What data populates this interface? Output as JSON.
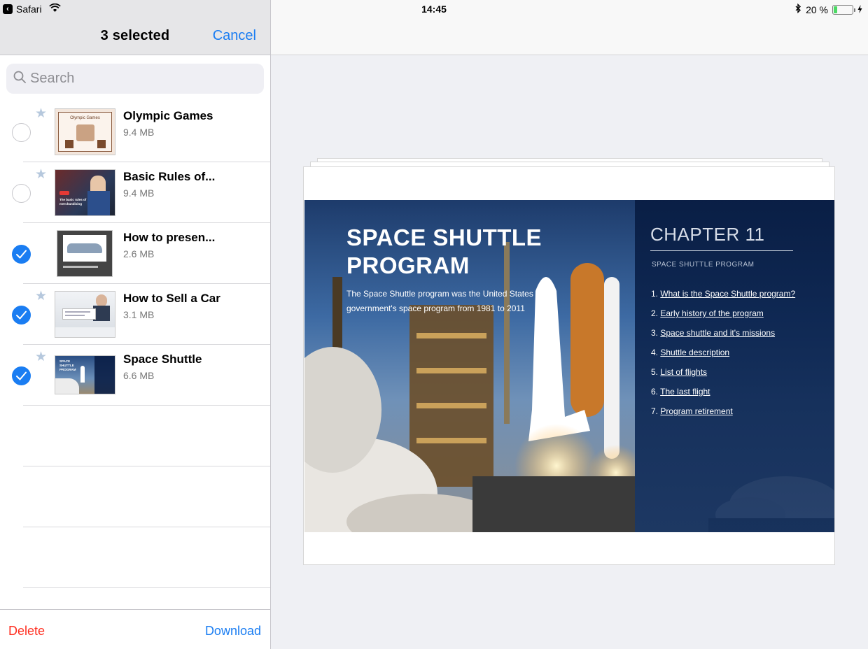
{
  "status_bar": {
    "app": "Safari",
    "time": "14:45",
    "battery_text": "20 %",
    "battery_level": 0.2
  },
  "left_panel": {
    "title": "3 selected",
    "cancel_label": "Cancel",
    "search_placeholder": "Search",
    "items": [
      {
        "name": "Olympic Games",
        "size": "9.4 MB",
        "selected": false,
        "starred": true,
        "thumb_title": "Olympic Games"
      },
      {
        "name": "Basic Rules of...",
        "size": "9.4 MB",
        "selected": false,
        "starred": true,
        "thumb_title": "The basic rules of merchandising"
      },
      {
        "name": "How to presen...",
        "size": "2.6 MB",
        "selected": true,
        "starred": false
      },
      {
        "name": "How to Sell a Car",
        "size": "3.1 MB",
        "selected": true,
        "starred": true
      },
      {
        "name": "Space Shuttle",
        "size": "6.6 MB",
        "selected": true,
        "starred": true,
        "thumb_title": "SPACE SHUTTLE PROGRAM"
      }
    ],
    "delete_label": "Delete",
    "download_label": "Download"
  },
  "preview": {
    "headline": "SPACE SHUTTLE PROGRAM",
    "subtitle": "The Space Shuttle program was the United States government's space program from 1981 to 2011",
    "chapter": "CHAPTER 11",
    "chapter_subtitle": "SPACE SHUTTLE PROGRAM",
    "toc": [
      {
        "num": "1.",
        "text": "What is the Space Shuttle program?"
      },
      {
        "num": "2.",
        "text": "Early history of the program"
      },
      {
        "num": "3.",
        "text": "Space shuttle and it's missions"
      },
      {
        "num": "4.",
        "text": "Shuttle description"
      },
      {
        "num": "5.",
        "text": "List of flights"
      },
      {
        "num": "6.",
        "text": "The last flight"
      },
      {
        "num": "7.",
        "text": "Program retirement"
      }
    ]
  },
  "colors": {
    "accent": "#1a7df2",
    "destructive": "#ff2d1f",
    "star": "#b6c8dd",
    "battery": "#4cd964"
  }
}
